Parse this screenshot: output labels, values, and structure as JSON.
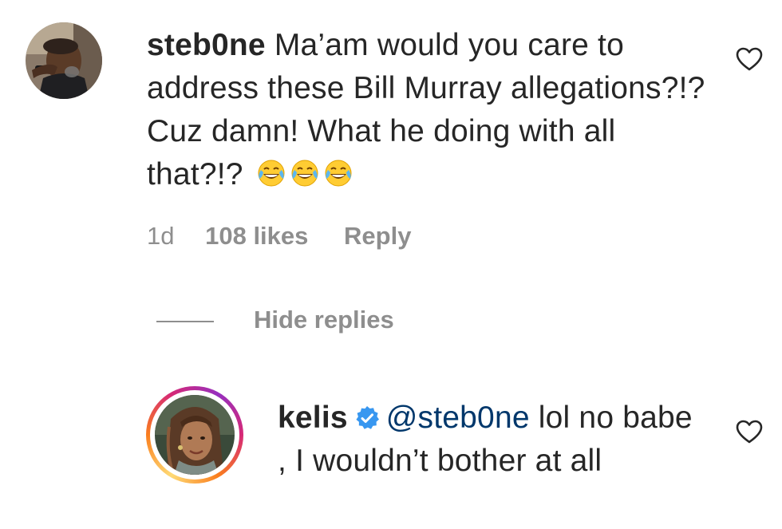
{
  "comments": [
    {
      "username": "steb0ne",
      "text": "Ma’am would you care to address these Bill Murray allegations?!? Cuz damn! What he doing with all that?!?",
      "emoji": "😂😂😂",
      "time": "1d",
      "likes": "108 likes",
      "reply_label": "Reply",
      "like_icon": "heart-outline-icon"
    }
  ],
  "replies_toggle": {
    "label": "Hide replies"
  },
  "replies": [
    {
      "username": "kelis",
      "verified": true,
      "mention": "@steb0ne",
      "text": "lol no babe , I wouldn’t bother at all",
      "like_icon": "heart-outline-icon"
    }
  ],
  "colors": {
    "text": "#262626",
    "meta": "#8e8e8e",
    "mention": "#00376b",
    "verified": "#3897f0",
    "story_ring": [
      "#feda75",
      "#fa7e1e",
      "#d62976",
      "#962fbf"
    ]
  }
}
